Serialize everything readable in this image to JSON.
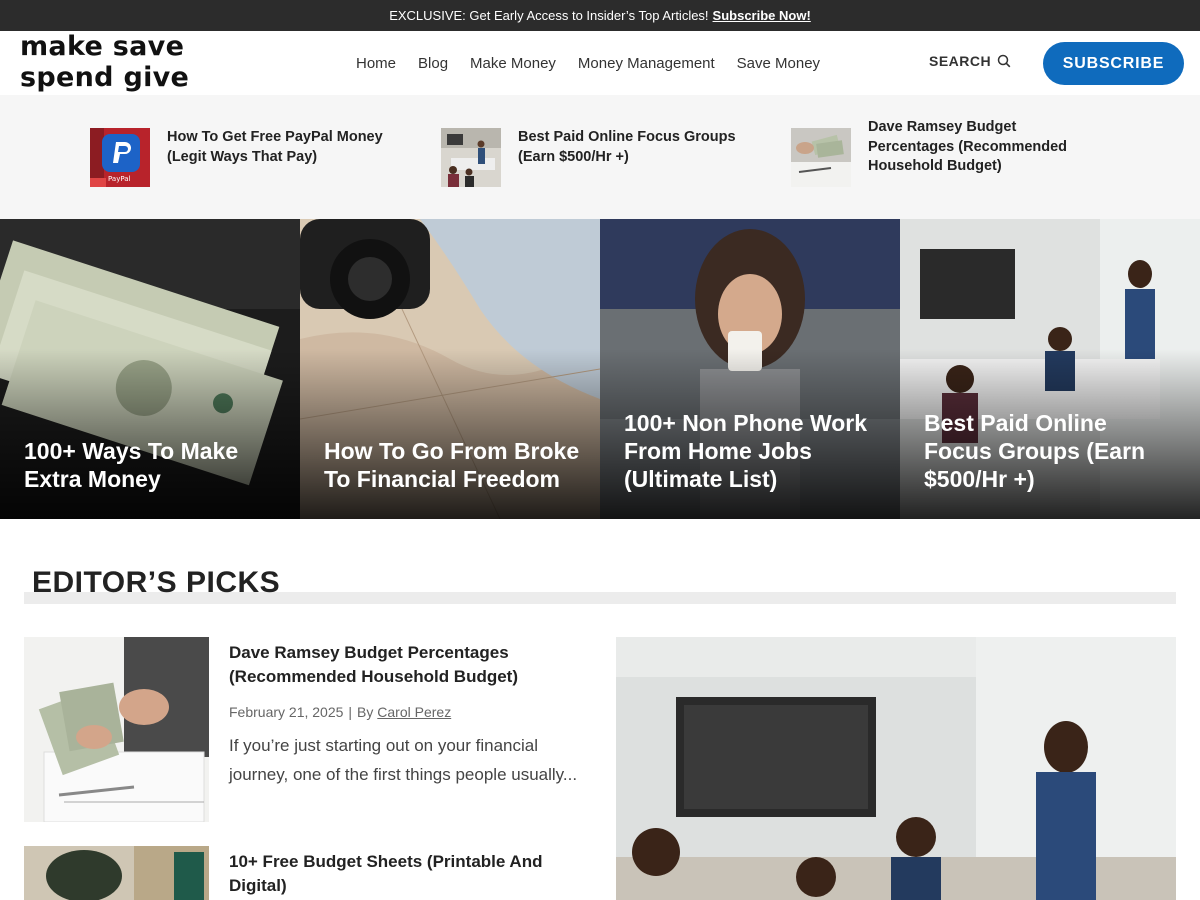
{
  "topbar": {
    "message": "EXCLUSIVE: Get Early Access to Insider’s Top Articles!",
    "link": "Subscribe Now!"
  },
  "header": {
    "logo_line1": "make save",
    "logo_line2": "spend give",
    "nav": [
      "Home",
      "Blog",
      "Make Money",
      "Money Management",
      "Save Money"
    ],
    "search_label": "SEARCH",
    "subscribe_label": "SUBSCRIBE"
  },
  "trending": [
    {
      "title": "How To Get Free PayPal Money (Legit Ways That Pay)",
      "thumb_icon": "paypal-app-icon"
    },
    {
      "title": "Best Paid Online Focus Groups (Earn $500/Hr +)",
      "thumb_icon": "meeting-photo"
    },
    {
      "title": "Dave Ramsey Budget Percentages (Recommended Household Budget)",
      "thumb_icon": "cash-photo"
    }
  ],
  "featured": [
    {
      "title": "100+ Ways To Make Extra Money"
    },
    {
      "title": "How To Go From Broke To Financial Freedom"
    },
    {
      "title": "100+ Non Phone Work From Home Jobs (Ultimate List)"
    },
    {
      "title": "Best Paid Online Focus Groups (Earn $500/Hr +)"
    }
  ],
  "editors_picks": {
    "heading": "EDITOR’S PICKS",
    "items": [
      {
        "title": "Dave Ramsey Budget Percentages (Recommended Household Budget)",
        "date": "February 21, 2025",
        "by": "By",
        "author": "Carol Perez",
        "excerpt": "If you’re just starting out on your financial journey, one of the first things people usually..."
      },
      {
        "title": "10+ Free Budget Sheets (Printable And Digital)"
      }
    ]
  },
  "colors": {
    "accent": "#0f6bbd",
    "topbar_bg": "#2c2c2c",
    "strip_bg": "#f6f6f6"
  }
}
